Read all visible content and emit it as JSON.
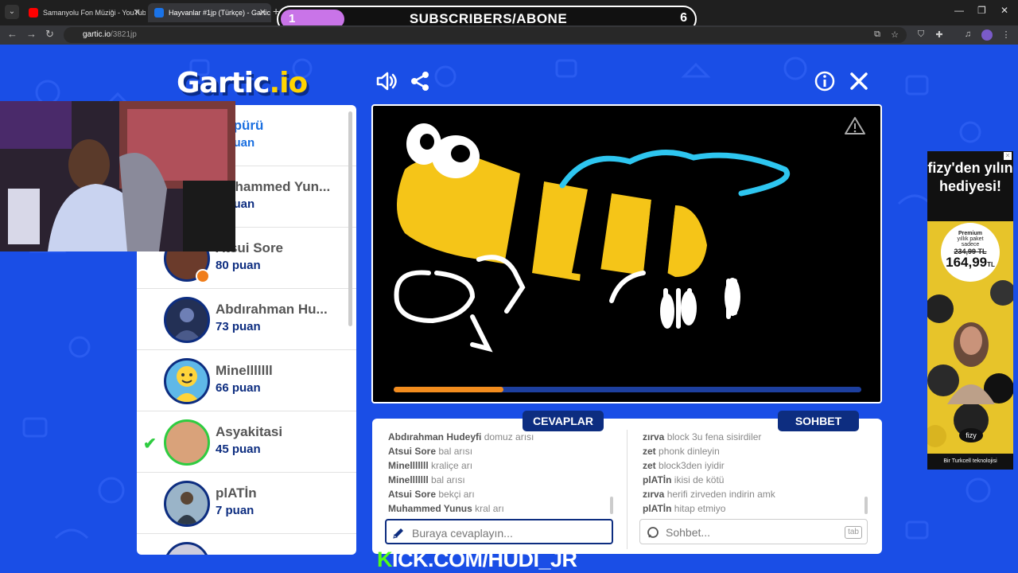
{
  "browser": {
    "tabs": [
      {
        "title": "Samanyolu Fon Müziği - YouTub",
        "favicon_color": "#ff0000"
      },
      {
        "title": "Hayvanlar #1jp (Türkçe) - Gartic",
        "favicon_color": "#1a73e8"
      }
    ],
    "url_site": "gartic.io",
    "url_path": "/3821jp"
  },
  "overlay": {
    "current": "1",
    "title": "SUBSCRIBERS/ABONE",
    "goal": "6"
  },
  "logo": {
    "text": "Gartic",
    "suffix": ".io"
  },
  "players": [
    {
      "name": "Köpürü",
      "points": "? puan",
      "partial": true
    },
    {
      "name": "Muhammed Yun...",
      "points": "? puan",
      "partial": true
    },
    {
      "name": "Atsui Sore",
      "points": "80 puan"
    },
    {
      "name": "Abdırahman Hu...",
      "points": "73 puan"
    },
    {
      "name": "Minelllllll",
      "points": "66 puan"
    },
    {
      "name": "Asyakitasi",
      "points": "45 puan",
      "guessed": true
    },
    {
      "name": "plATİn",
      "points": "7 puan"
    }
  ],
  "timer_fraction": 0.235,
  "answers": {
    "tab_label": "CEVAPLAR",
    "messages": [
      {
        "user": "Abdırahman Hudeyfi",
        "text": "domuz arısı"
      },
      {
        "user": "Atsui Sore",
        "text": "bal arısı"
      },
      {
        "user": "Minelllllll",
        "text": "kraliçe arı"
      },
      {
        "user": "Minelllllll",
        "text": "bal arısı"
      },
      {
        "user": "Atsui Sore",
        "text": "bekçi arı"
      },
      {
        "user": "Muhammed Yunus",
        "text": "kral arı"
      }
    ],
    "placeholder": "Buraya cevaplayın..."
  },
  "chat": {
    "tab_label": "SOHBET",
    "messages": [
      {
        "user": "zırva",
        "text": "block 3u fena sisirdiler"
      },
      {
        "user": "zet",
        "text": "phonk dinleyin"
      },
      {
        "user": "zet",
        "text": "block3den iyidir"
      },
      {
        "user": "plATİn",
        "text": "ikisi de kötü"
      },
      {
        "user": "zırva",
        "text": "herifi zirveden indirin amk"
      },
      {
        "user": "plATİn",
        "text": "hitap etmiyo"
      }
    ],
    "placeholder": "Sohbet...",
    "tab_key": "tab"
  },
  "ad": {
    "headline": "fizy'den yılın hediyesi!",
    "circle_line1": "Premium",
    "circle_line2": "yıllık paket",
    "circle_line3": "sadece",
    "old_price": "234,99 TL",
    "new_price": "164,99",
    "currency": "TL",
    "brand": "fizy",
    "footer": "Bir Turkcell teknolojisi"
  },
  "stream": {
    "kick_prefix": "K",
    "kick_rest": "ICK.COM/HUDI_JR"
  },
  "colors": {
    "background": "#1a4ee6",
    "navy": "#0d2d80",
    "timer": "#f28c1e",
    "bee": "#f5c518",
    "kick_green": "#53fc18"
  }
}
